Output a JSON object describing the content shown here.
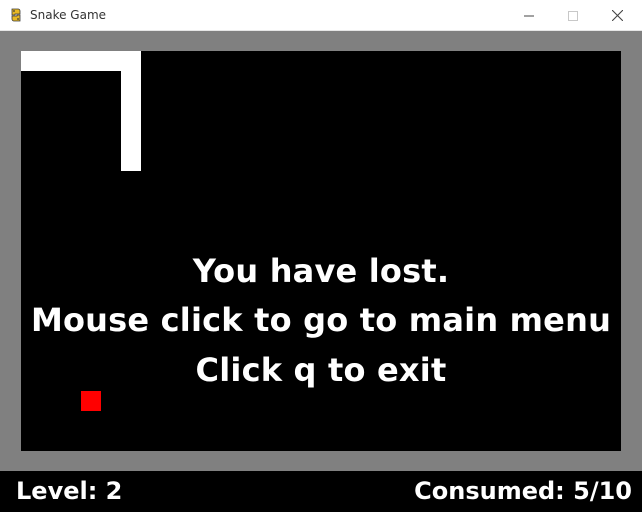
{
  "window": {
    "title": "Snake Game",
    "icons": {
      "app": "python-snake-icon",
      "minimize": "minimize-icon",
      "maximize": "maximize-icon",
      "close": "close-icon"
    }
  },
  "game": {
    "messages": [
      "You have lost.",
      "Mouse click to go to main menu",
      "Click q to exit"
    ],
    "colors": {
      "background": "#000000",
      "snake": "#ffffff",
      "food": "#ff0000",
      "border": "#808080"
    }
  },
  "status": {
    "level": "Level: 2",
    "consumed": "Consumed: 5/10"
  }
}
